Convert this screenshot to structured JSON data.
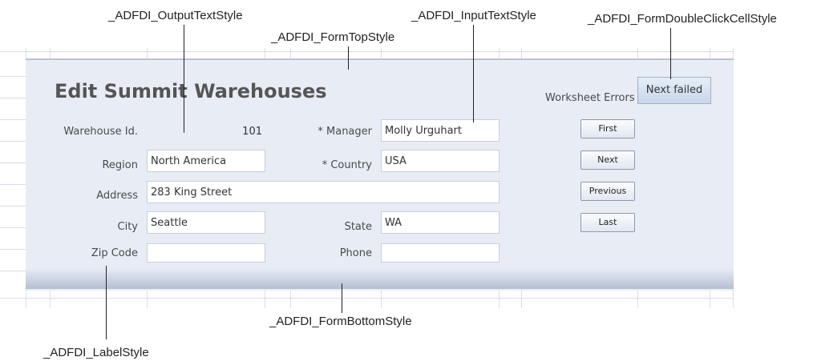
{
  "form": {
    "title": "Edit Summit Warehouses",
    "worksheet_errors_label": "Worksheet Errors",
    "next_failed_label": "Next failed",
    "fields": {
      "warehouse_id_label": "Warehouse Id.",
      "warehouse_id_value": "101",
      "manager_label": "* Manager",
      "manager_value": "Molly Urguhart",
      "region_label": "Region",
      "region_value": "North America",
      "country_label": "* Country",
      "country_value": "USA",
      "address_label": "Address",
      "address_value": "283 King Street",
      "city_label": "City",
      "city_value": "Seattle",
      "state_label": "State",
      "state_value": "WA",
      "zip_label": "Zip Code",
      "zip_value": "",
      "phone_label": "Phone",
      "phone_value": ""
    },
    "nav_buttons": {
      "first": "First",
      "next": "Next",
      "previous": "Previous",
      "last": "Last"
    }
  },
  "callouts": {
    "output_text_style": "_ADFDI_OutputTextStyle",
    "input_text_style": "_ADFDI_InputTextStyle",
    "form_double_click_cell_style": "_ADFDI_FormDoubleClickCellStyle",
    "form_top_style": "_ADFDI_FormTopStyle",
    "form_bottom_style": "_ADFDI_FormBottomStyle",
    "label_style": "_ADFDI_LabelStyle"
  },
  "colors": {
    "form_background": "#e8ecf5",
    "gridline": "#d9deea",
    "title_text": "#555555",
    "button_border": "#8e99ad"
  }
}
